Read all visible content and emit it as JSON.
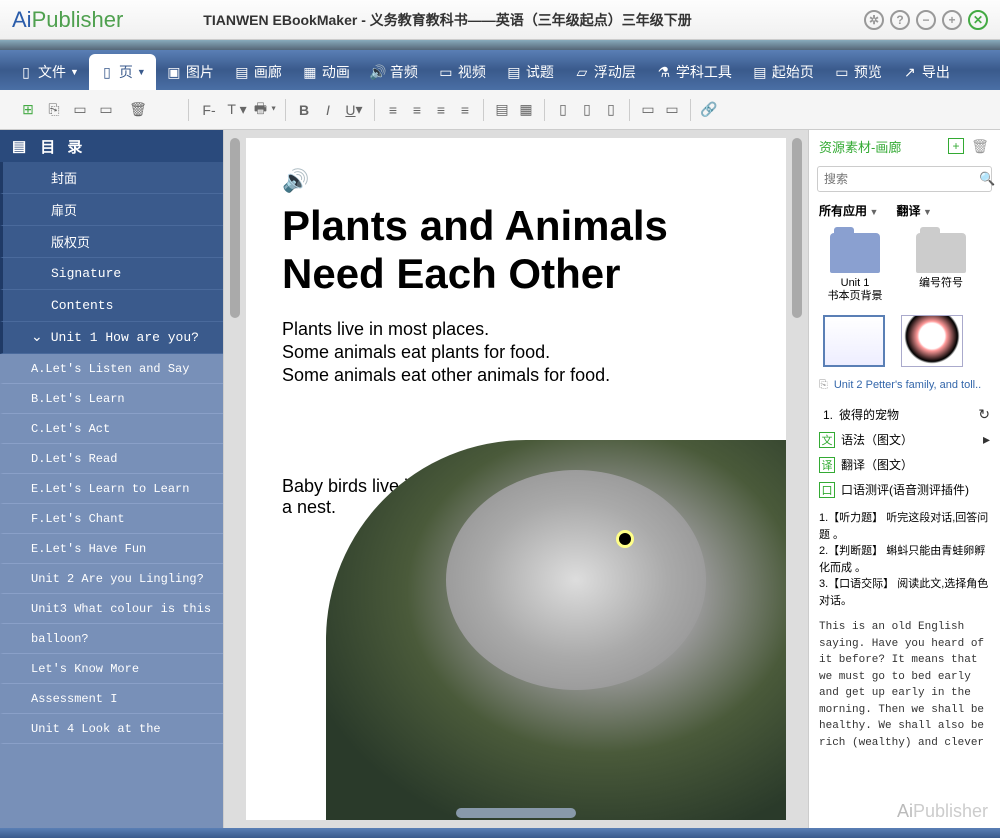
{
  "titlebar": {
    "app": "TIANWEN EBookMaker",
    "sep": " - ",
    "doc": "义务教育教科书——英语（三年级起点）三年级下册"
  },
  "logo": {
    "a": "Ai",
    "b": "Publisher"
  },
  "ribbon": [
    {
      "icon": "file",
      "label": "文件",
      "caret": true
    },
    {
      "icon": "page",
      "label": "页",
      "caret": true,
      "active": true
    },
    {
      "icon": "image",
      "label": "图片"
    },
    {
      "icon": "gallery",
      "label": "画廊"
    },
    {
      "icon": "anim",
      "label": "动画"
    },
    {
      "icon": "audio",
      "label": "音频"
    },
    {
      "icon": "video",
      "label": "视频"
    },
    {
      "icon": "quiz",
      "label": "试题"
    },
    {
      "icon": "float",
      "label": "浮动层"
    },
    {
      "icon": "tool",
      "label": "学科工具"
    },
    {
      "icon": "home",
      "label": "起始页"
    },
    {
      "icon": "preview",
      "label": "预览"
    },
    {
      "icon": "export",
      "label": "导出"
    }
  ],
  "sidebar": {
    "header": "目 录",
    "items": [
      {
        "label": "封面",
        "level": 1
      },
      {
        "label": "扉页",
        "level": 1
      },
      {
        "label": "版权页",
        "level": 1
      },
      {
        "label": "Signature",
        "level": 1
      },
      {
        "label": "Contents",
        "level": 1
      },
      {
        "label": "Unit 1 How are you?",
        "level": 1,
        "expand": true
      },
      {
        "label": "A.Let's Listen and Say",
        "level": 2
      },
      {
        "label": "B.Let's Learn",
        "level": 2
      },
      {
        "label": "C.Let's Act",
        "level": 2
      },
      {
        "label": "D.Let's Read",
        "level": 2
      },
      {
        "label": "E.Let's Learn to Learn",
        "level": 2
      },
      {
        "label": "F.Let's Chant",
        "level": 2
      },
      {
        "label": "E.Let's Have Fun",
        "level": 2
      },
      {
        "label": "Unit 2 Are you Lingling?",
        "level": 2
      },
      {
        "label": "Unit3 What colour is this",
        "level": 2
      },
      {
        "label": "balloon?",
        "level": 2
      },
      {
        "label": "Let's Know More",
        "level": 2
      },
      {
        "label": "Assessment I",
        "level": 2
      },
      {
        "label": "Unit 4 Look at the",
        "level": 2
      }
    ]
  },
  "page": {
    "title_l1": "Plants and Animals",
    "title_l2": "Need Each Other",
    "p1": "Plants live in most places.",
    "p2": "Some animals eat plants for food.",
    "p3": "Some animals eat other animals for food.",
    "caption_l1": "Baby birds live in",
    "caption_l2": "a nest."
  },
  "right": {
    "section": "资源素材-画廊",
    "search_ph": "搜索",
    "filter1": "所有应用",
    "filter2": "翻译",
    "folder1_l1": "Unit 1",
    "folder1_l2": "书本页背景",
    "folder2": "编号符号",
    "link": "Unit  2 Petter's family, and toll..",
    "rows": [
      {
        "n": "1.",
        "label": "彼得的宠物",
        "ic": "none",
        "act": "↻"
      },
      {
        "n": "",
        "label": "语法（图文）",
        "ic": "文",
        "act": "▸"
      },
      {
        "n": "",
        "label": "翻译（图文）",
        "ic": "译",
        "act": ""
      },
      {
        "n": "",
        "label": "口语测评(语音测评插件)",
        "ic": "口",
        "act": ""
      }
    ],
    "q1": "1.【听力题】 听完这段对话,回答问题 。",
    "q2": "2.【判断题】 蝌蚪只能由青蛙卵孵化而成 。",
    "q3": "3.【口语交际】 阅读此文,选择角色对话。",
    "eng": "    This is an old English saying. Have you heard of it before? It means that we must go to bed early and get up early in the morning. Then we shall be healthy. We shall also be rich (wealthy) and clever",
    "foot_a": "Ai",
    "foot_b": "Publisher"
  }
}
